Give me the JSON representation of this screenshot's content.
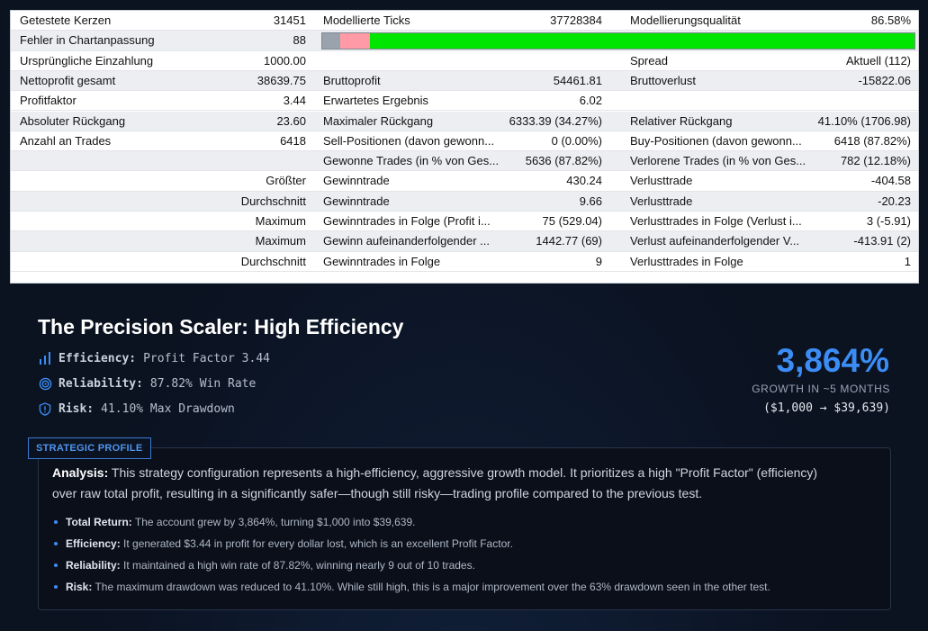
{
  "report": {
    "rows": [
      [
        "Getestete Kerzen",
        "31451",
        "Modellierte Ticks",
        "37728384",
        "Modellierungsqualität",
        "86.58%"
      ],
      [
        "Fehler in Chartanpassung",
        "88",
        "",
        "",
        "",
        ""
      ],
      [
        "Ursprüngliche Einzahlung",
        "1000.00",
        "",
        "",
        "Spread",
        "Aktuell (112)"
      ],
      [
        "Nettoprofit gesamt",
        "38639.75",
        "Bruttoprofit",
        "54461.81",
        "Bruttoverlust",
        "-15822.06"
      ],
      [
        "Profitfaktor",
        "3.44",
        "Erwartetes Ergebnis",
        "6.02",
        "",
        ""
      ],
      [
        "Absoluter Rückgang",
        "23.60",
        "Maximaler Rückgang",
        "6333.39 (34.27%)",
        "Relativer Rückgang",
        "41.10% (1706.98)"
      ],
      [
        "Anzahl an Trades",
        "6418",
        "Sell-Positionen (davon gewonn...",
        "0 (0.00%)",
        "Buy-Positionen (davon gewonn...",
        "6418 (87.82%)"
      ],
      [
        "",
        "",
        "Gewonne Trades (in % von Ges...",
        "5636 (87.82%)",
        "Verlorene Trades (in % von Ges...",
        "782 (12.18%)"
      ],
      [
        "",
        "Größter",
        "Gewinntrade",
        "430.24",
        "Verlusttrade",
        "-404.58"
      ],
      [
        "",
        "Durchschnitt",
        "Gewinntrade",
        "9.66",
        "Verlusttrade",
        "-20.23"
      ],
      [
        "",
        "Maximum",
        "Gewinntrades in Folge (Profit i...",
        "75 (529.04)",
        "Verlusttrades in Folge (Verlust i...",
        "3 (-5.91)"
      ],
      [
        "",
        "Maximum",
        "Gewinn aufeinanderfolgender ...",
        "1442.77 (69)",
        "Verlust aufeinanderfolgender V...",
        "-413.91 (2)"
      ],
      [
        "",
        "Durchschnitt",
        "Gewinntrades in Folge",
        "9",
        "Verlusttrades in Folge",
        "1"
      ]
    ],
    "quality_bar": {
      "grey_fraction": 0.03,
      "pink_fraction": 0.05,
      "green_fraction": 0.92
    }
  },
  "summary": {
    "title": "The Precision Scaler: High Efficiency",
    "metrics": [
      {
        "icon": "bar-chart-icon",
        "label": "Efficiency:",
        "value": "Profit Factor 3.44"
      },
      {
        "icon": "target-icon",
        "label": "Reliability:",
        "value": "87.82% Win Rate"
      },
      {
        "icon": "shield-icon",
        "label": "Risk:",
        "value": "41.10% Max Drawdown"
      }
    ],
    "growth_value": "3,864%",
    "growth_caption": "GROWTH IN ~5 MONTHS",
    "growth_detail": "($1,000 → $39,639)"
  },
  "profile": {
    "tag": "STRATEGIC PROFILE",
    "analysis_label": "Analysis:",
    "analysis_text": " This strategy configuration represents a high-efficiency, aggressive growth model. It prioritizes a high \"Profit Factor\" (efficiency) over raw total profit, resulting in a significantly safer—though still risky—trading profile compared to the previous test.",
    "bullets": [
      {
        "label": "Total Return:",
        "text": " The account grew by 3,864%, turning $1,000 into $39,639."
      },
      {
        "label": "Efficiency:",
        "text": " It generated $3.44 in profit for every dollar lost, which is an excellent Profit Factor."
      },
      {
        "label": "Reliability:",
        "text": " It maintained a high win rate of 87.82%, winning nearly 9 out of 10 trades."
      },
      {
        "label": "Risk:",
        "text": " The maximum drawdown was reduced to 41.10%. While still high, this is a major improvement over the 63% drawdown seen in the other test."
      }
    ]
  },
  "colors": {
    "accent": "#3b8cf5",
    "bar_green": "#00e600",
    "bar_pink": "#ff9aa6",
    "bar_grey": "#9aa2ad"
  }
}
